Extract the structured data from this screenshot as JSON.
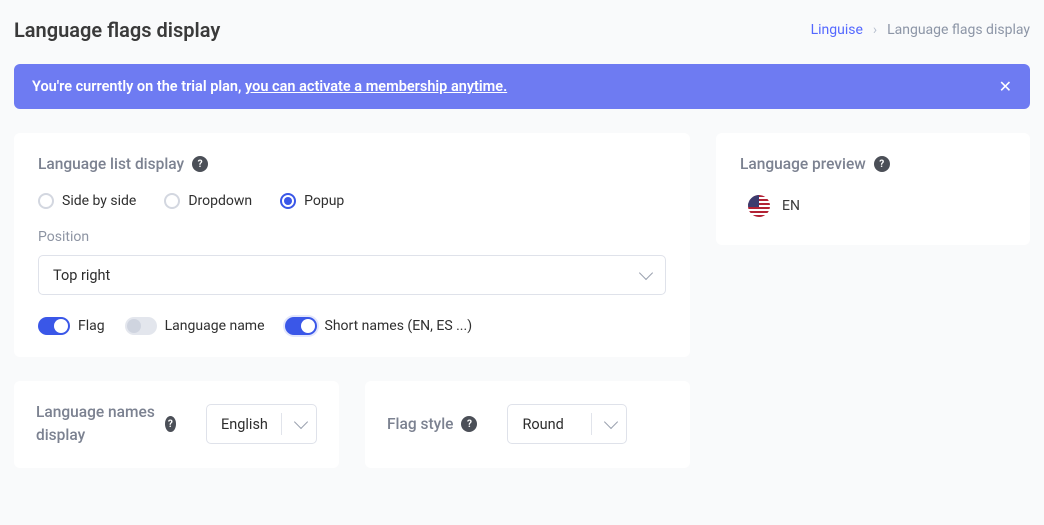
{
  "header": {
    "title": "Language flags display",
    "breadcrumb_root": "Linguise",
    "breadcrumb_current": "Language flags display"
  },
  "trial": {
    "prefix": "You're currently on the trial plan, ",
    "link": "you can activate a membership anytime."
  },
  "listDisplay": {
    "title": "Language list display",
    "radios": {
      "side": "Side by side",
      "dropdown": "Dropdown",
      "popup": "Popup"
    },
    "position_label": "Position",
    "position_value": "Top right",
    "toggles": {
      "flag": "Flag",
      "langname": "Language name",
      "short": "Short names (EN, ES ...)"
    }
  },
  "namesDisplay": {
    "title": "Language names display",
    "value": "English"
  },
  "flagStyle": {
    "title": "Flag style",
    "value": "Round"
  },
  "preview": {
    "title": "Language preview",
    "code": "EN"
  }
}
